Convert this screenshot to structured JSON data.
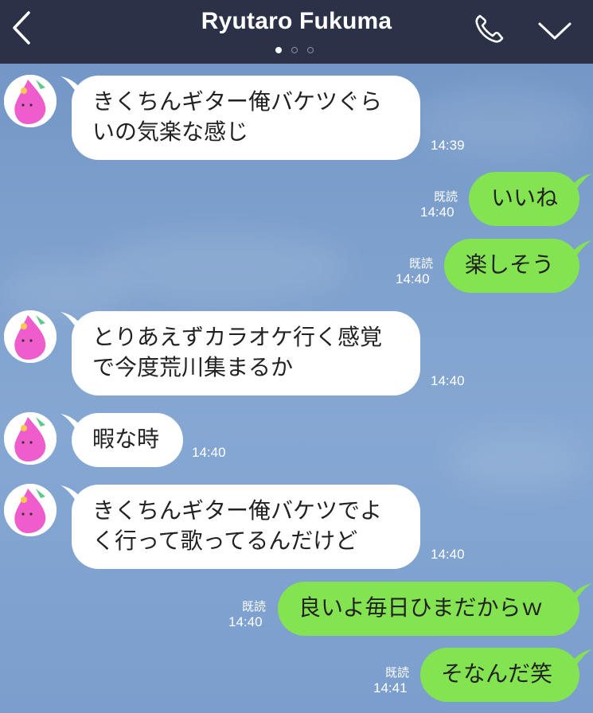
{
  "header": {
    "title": "Ryutaro Fukuma",
    "back_icon": "chevron-left-icon",
    "call_icon": "phone-icon",
    "menu_icon": "chevron-down-icon",
    "page_count": 3,
    "active_page": 1,
    "background": "#2b3247"
  },
  "colors": {
    "outgoing_bubble": "#84e351",
    "incoming_bubble": "#ffffff",
    "chat_background": "#7c9ece"
  },
  "messages": [
    {
      "direction": "incoming",
      "lines": [
        "きくちんギター俺バケツぐら",
        "いの気楽な感じ"
      ],
      "time": "14:39"
    },
    {
      "direction": "outgoing",
      "lines": [
        "いいね"
      ],
      "read": "既読",
      "time": "14:40"
    },
    {
      "direction": "outgoing",
      "lines": [
        "楽しそう"
      ],
      "read": "既読",
      "time": "14:40"
    },
    {
      "direction": "incoming",
      "lines": [
        "とりあえずカラオケ行く感覚",
        "で今度荒川集まるか"
      ],
      "time": "14:40"
    },
    {
      "direction": "incoming",
      "lines": [
        "暇な時"
      ],
      "time": "14:40"
    },
    {
      "direction": "incoming",
      "lines": [
        "きくちんギター俺バケツでよ",
        "く行って歌ってるんだけど"
      ],
      "time": "14:40"
    },
    {
      "direction": "outgoing",
      "lines": [
        "良いよ毎日ひまだからｗ"
      ],
      "read": "既読",
      "time": "14:40"
    },
    {
      "direction": "outgoing",
      "lines": [
        "そなんだ笑"
      ],
      "read": "既読",
      "time": "14:41"
    }
  ]
}
